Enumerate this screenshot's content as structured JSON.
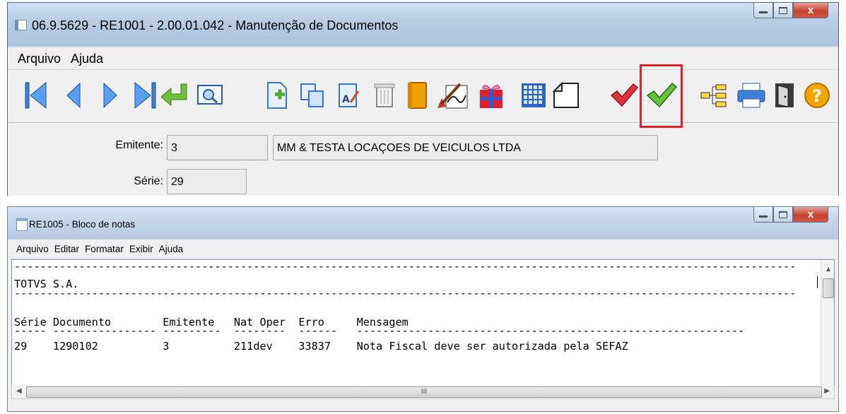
{
  "window1": {
    "title": "06.9.5629 - RE1001 - 2.00.01.042 - Manutenção de Documentos",
    "menu": [
      "Arquivo",
      "Ajuda"
    ],
    "toolbar_icons": [
      "first-record-icon",
      "prev-record-icon",
      "next-record-icon",
      "last-record-icon",
      "goto-icon",
      "search-icon",
      "new-record-icon",
      "copy-icon",
      "edit-icon",
      "delete-icon",
      "book-icon",
      "signature-icon",
      "gift-icon",
      "grid-icon",
      "page-icon",
      "check-red-icon",
      "check-green-icon",
      "tree-icon",
      "print-icon",
      "exit-door-icon",
      "help-icon"
    ],
    "form": {
      "emitente_label": "Emitente:",
      "emitente_value": "3",
      "emitente_name": "MM & TESTA LOCAÇOES DE VEICULOS LTDA",
      "serie_label": "Série:",
      "serie_value": "29"
    },
    "colors": {
      "highlight": "#e2202a"
    }
  },
  "window2": {
    "title": "RE1005 - Bloco de notas",
    "menu": [
      "Arquivo",
      "Editar",
      "Formatar",
      "Exibir",
      "Ajuda"
    ],
    "lines": {
      "sep1": "-------------------------------------------------------------------------------------------------------------------------",
      "company": "TOTVS S.A.",
      "sep2": "-------------------------------------------------------------------------------------------------------------------------",
      "header": "Série Documento        Emitente   Nat Oper  Erro     Mensagem",
      "underline": "----- ---------------- ---------  --------  ------   ------------------------------------------------------------",
      "row": "29    1290102          3          211dev    33837    Nota Fiscal deve ser autorizada pela SEFAZ"
    },
    "hscroll_thumb": "III"
  }
}
